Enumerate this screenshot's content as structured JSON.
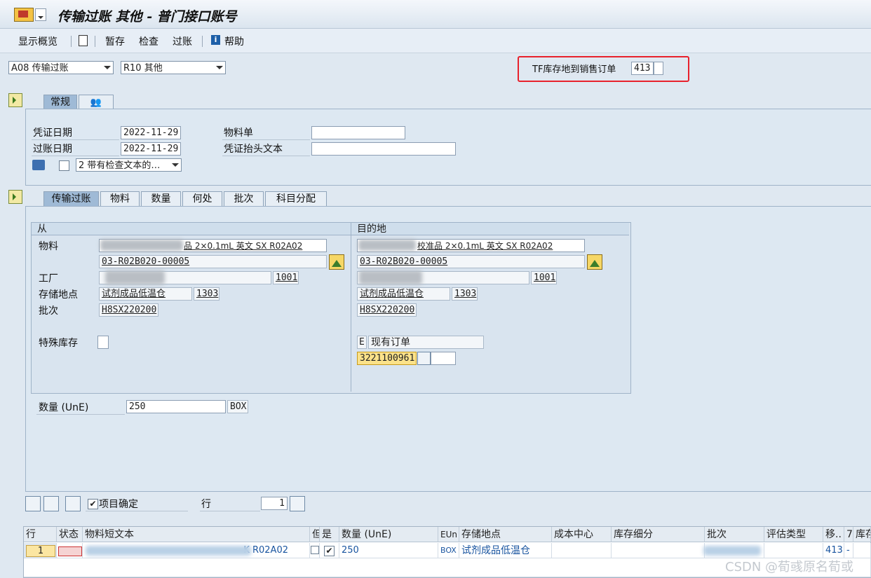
{
  "window": {
    "title": "传输过账 其他 - 普门接口账号"
  },
  "toolbar": {
    "items": [
      "显示概览",
      "暂存",
      "检查",
      "过账",
      "帮助"
    ]
  },
  "header": {
    "movement_select": "A08 传输过账",
    "reason_select": "R10 其他",
    "movement_type_label": "TF库存地到销售订单",
    "movement_type_value": "413"
  },
  "general_tabs": [
    "常规"
  ],
  "general": {
    "doc_date_label": "凭证日期",
    "doc_date": "2022-11-29",
    "post_date_label": "过账日期",
    "post_date": "2022-11-29",
    "material_slip_label": "物料单",
    "header_text_label": "凭证抬头文本",
    "print_option": "2 带有检查文本的…"
  },
  "item_tabs": [
    "传输过账",
    "物料",
    "数量",
    "何处",
    "批次",
    "科目分配"
  ],
  "from": {
    "title": "从",
    "material_label": "物料",
    "material_text": "品 2×0.1mL 英文 SX R02A02",
    "material_code": "03-R02B020-00005",
    "plant_label": "工厂",
    "plant_code": "1001",
    "sloc_label": "存储地点",
    "sloc_text": "试剂成品低温仓",
    "sloc_code": "1303",
    "batch_label": "批次",
    "batch": "H8SX220200",
    "special_stock_label": "特殊库存"
  },
  "to": {
    "title": "目的地",
    "material_text": "校准品 2×0.1mL 英文 SX R02A02",
    "material_code": "03-R02B020-00005",
    "plant_code": "1001",
    "sloc_text": "试剂成品低温仓",
    "sloc_code": "1303",
    "batch": "H8SX220200",
    "special_stock_flag": "E",
    "special_stock_text": "现有订单",
    "sales_order": "3221100961"
  },
  "quantity": {
    "label": "数量 (UnE)",
    "value": "250",
    "unit": "BOX"
  },
  "item_controls": {
    "item_ok_label": "项目确定",
    "row_label": "行",
    "row_value": "1"
  },
  "grid": {
    "headers": [
      "行",
      "状态",
      "物料短文本",
      "但",
      "是",
      "数量 (UnE)",
      "EUn",
      "存储地点",
      "成本中心",
      "库存细分",
      "批次",
      "评估类型",
      "移..",
      "7",
      "库存"
    ],
    "row": {
      "line": "1",
      "material_short": "K R02A02",
      "qty": "250",
      "unit": "BOX",
      "sloc": "试剂成品低温仓",
      "movement": "413",
      "dash": "-"
    }
  },
  "watermark": "CSDN @荀彧原名荀或"
}
